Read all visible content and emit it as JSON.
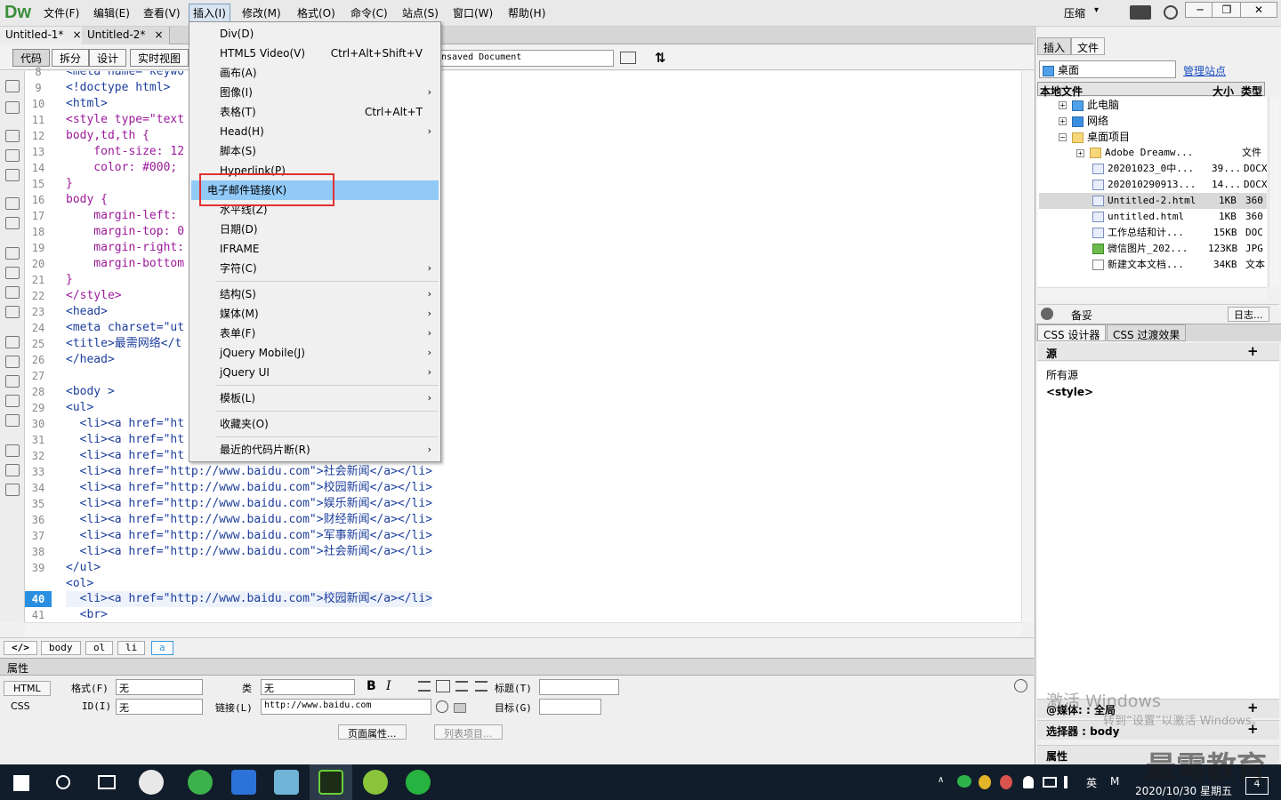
{
  "app": {
    "logo": "Dw"
  },
  "menubar": {
    "items": [
      "文件(F)",
      "编辑(E)",
      "查看(V)",
      "插入(I)",
      "修改(M)",
      "格式(O)",
      "命令(C)",
      "站点(S)",
      "窗口(W)",
      "帮助(H)"
    ],
    "compress_label": "压缩",
    "compress_arrow": "▾",
    "win_min": "─",
    "win_restore": "❐",
    "win_close": "✕"
  },
  "tabs": [
    {
      "label": "Untitled-1*",
      "close": "×"
    },
    {
      "label": "Untitled-2*",
      "close": "×"
    }
  ],
  "view_buttons": [
    "代码",
    "拆分",
    "设计",
    "实时视图"
  ],
  "title_field": "nsaved Document",
  "code": {
    "line_numbers": [
      "8",
      "9",
      "10",
      "11",
      "12",
      "13",
      "14",
      "15",
      "16",
      "17",
      "18",
      "19",
      "20",
      "21",
      "22",
      "23",
      "24",
      "25",
      "26",
      "27",
      "28",
      "29",
      "30",
      "31",
      "32",
      "33",
      "34",
      "35",
      "36",
      "37",
      "38",
      "39",
      "40",
      "41"
    ],
    "current_line": "40",
    "lines": [
      "<meta name=\"keywo",
      "<!doctype html>",
      "<html>",
      "<style type=\"text",
      "body,td,th {",
      "    font-size: 12",
      "    color: #000;",
      "}",
      "body {",
      "    margin-left: ",
      "    margin-top: 0",
      "    margin-right:",
      "    margin-bottom",
      "}",
      "</style>",
      "<head>",
      "<meta charset=\"ut",
      "<title>最需网络</t",
      "</head>",
      "",
      "<body >",
      "<ul>",
      "  <li><a href=\"ht",
      "  <li><a href=\"ht",
      "  <li><a href=\"ht",
      "  <li><a href=\"http://www.baidu.com\">社会新闻</a></li>",
      "  <li><a href=\"http://www.baidu.com\">校园新闻</a></li>",
      "  <li><a href=\"http://www.baidu.com\">娱乐新闻</a></li>",
      "  <li><a href=\"http://www.baidu.com\">财经新闻</a></li>",
      "  <li><a href=\"http://www.baidu.com\">军事新闻</a></li>",
      "  <li><a href=\"http://www.baidu.com\">社会新闻</a></li>",
      "</ul>",
      "<ol>",
      "  <li><a href=\"http://www.baidu.com\">校园新闻</a></li>",
      "  <br>"
    ]
  },
  "tag_selector": [
    "</>",
    "body",
    "ol",
    "li",
    "a"
  ],
  "insert_menu": {
    "items": [
      {
        "label": "Div(D)",
        "shortcut": "",
        "arrow": ""
      },
      {
        "label": "HTML5 Video(V)",
        "shortcut": "Ctrl+Alt+Shift+V",
        "arrow": ""
      },
      {
        "label": "画布(A)",
        "shortcut": "",
        "arrow": ""
      },
      {
        "label": "图像(I)",
        "shortcut": "",
        "arrow": "›"
      },
      {
        "label": "表格(T)",
        "shortcut": "Ctrl+Alt+T",
        "arrow": ""
      },
      {
        "label": "Head(H)",
        "shortcut": "",
        "arrow": "›"
      },
      {
        "label": "脚本(S)",
        "shortcut": "",
        "arrow": ""
      },
      {
        "label": "Hyperlink(P)",
        "shortcut": "",
        "arrow": ""
      },
      {
        "label": "电子邮件链接(K)",
        "shortcut": "",
        "arrow": ""
      },
      {
        "label": "水平线(Z)",
        "shortcut": "",
        "arrow": ""
      },
      {
        "label": "日期(D)",
        "shortcut": "",
        "arrow": ""
      },
      {
        "label": "IFRAME",
        "shortcut": "",
        "arrow": ""
      },
      {
        "label": "字符(C)",
        "shortcut": "",
        "arrow": "›"
      },
      {
        "label": "结构(S)",
        "shortcut": "",
        "arrow": "›"
      },
      {
        "label": "媒体(M)",
        "shortcut": "",
        "arrow": "›"
      },
      {
        "label": "表单(F)",
        "shortcut": "",
        "arrow": "›"
      },
      {
        "label": "jQuery Mobile(J)",
        "shortcut": "",
        "arrow": "›"
      },
      {
        "label": "jQuery UI",
        "shortcut": "",
        "arrow": "›"
      },
      {
        "label": "模板(L)",
        "shortcut": "",
        "arrow": "›"
      },
      {
        "label": "收藏夹(O)",
        "shortcut": "",
        "arrow": ""
      },
      {
        "label": "最近的代码片断(R)",
        "shortcut": "",
        "arrow": "›"
      }
    ],
    "highlighted_index": 8
  },
  "properties": {
    "title": "属性",
    "html_btn": "HTML",
    "css_btn": "CSS",
    "format_label": "格式(F)",
    "format_value": "无",
    "id_label": "ID(I)",
    "id_value": "无",
    "class_label": "类",
    "class_value": "无",
    "link_label": "链接(L)",
    "link_value": "http://www.baidu.com",
    "title_label": "标题(T)",
    "target_label": "目标(G)",
    "page_props_btn": "页面属性...",
    "list_item_btn": "列表项目..."
  },
  "files_panel": {
    "tabs": [
      "插入",
      "文件"
    ],
    "location": "桌面",
    "manage_sites": "管理站点",
    "col_local": "本地文件",
    "col_size": "大小",
    "col_type": "类型",
    "rows": [
      {
        "expander": "+",
        "name": "此电脑",
        "size": "",
        "type": "",
        "icon": "pc",
        "indent": 0
      },
      {
        "expander": "+",
        "name": "网络",
        "size": "",
        "type": "",
        "icon": "net",
        "indent": 0
      },
      {
        "expander": "−",
        "name": "桌面项目",
        "size": "",
        "type": "",
        "icon": "folder",
        "indent": 0
      },
      {
        "expander": "+",
        "name": "Adobe Dreamw...",
        "size": "",
        "type": "文件",
        "icon": "folder",
        "indent": 1
      },
      {
        "expander": "",
        "name": "20201023_0中...",
        "size": "39...",
        "type": "DOCX",
        "icon": "doc",
        "indent": 1
      },
      {
        "expander": "",
        "name": "202010290913...",
        "size": "14...",
        "type": "DOCX",
        "icon": "doc",
        "indent": 1
      },
      {
        "expander": "",
        "name": "Untitled-2.html",
        "size": "1KB",
        "type": "360",
        "icon": "html",
        "indent": 1
      },
      {
        "expander": "",
        "name": "untitled.html",
        "size": "1KB",
        "type": "360",
        "icon": "html",
        "indent": 1
      },
      {
        "expander": "",
        "name": "工作总结和计...",
        "size": "15KB",
        "type": "DOC",
        "icon": "doc",
        "indent": 1
      },
      {
        "expander": "",
        "name": "微信图片_202...",
        "size": "123KB",
        "type": "JPG",
        "icon": "img",
        "indent": 1
      },
      {
        "expander": "",
        "name": "新建文本文档...",
        "size": "34KB",
        "type": "文本",
        "icon": "txt",
        "indent": 1
      }
    ],
    "selected_row": 6,
    "bottom_left": "备妥",
    "bottom_right": "日志..."
  },
  "css_panel": {
    "tabs": [
      "CSS 设计器",
      "CSS 过渡效果"
    ],
    "source_header": "源",
    "sources": [
      "所有源",
      "<style>"
    ],
    "media_label": "@媒体: : 全局",
    "selector_label": "选择器 : body",
    "props_label": "属性"
  },
  "taskbar": {
    "ime": "英",
    "ime2": "M",
    "date": "2020/10/30 星期五",
    "badge": "4"
  },
  "overlay": {
    "watermark": "最需教育",
    "activate_title": "激活 Windows",
    "activate_sub": "转到“设置”以激活 Windows。"
  }
}
